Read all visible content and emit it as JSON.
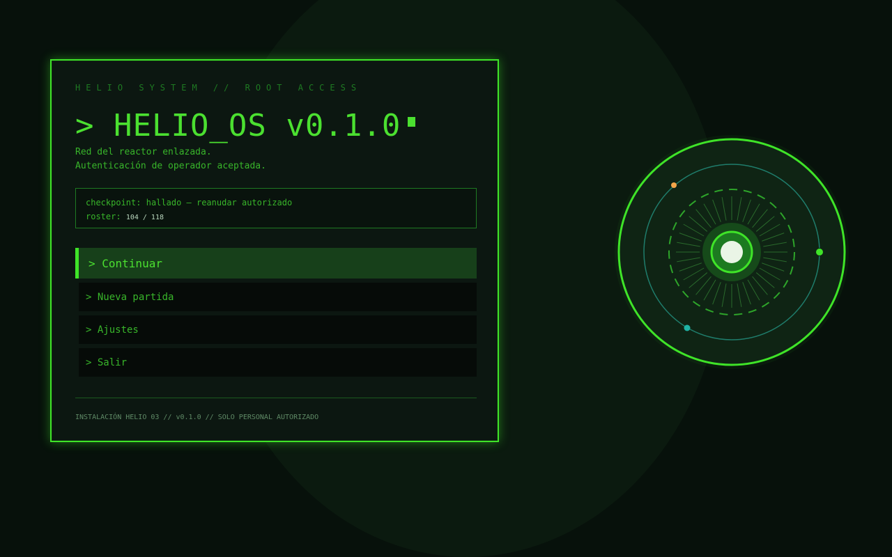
{
  "header": {
    "kicker": "HELIO SYSTEM // ROOT ACCESS",
    "title": "> HELIO_OS v0.1.0"
  },
  "status": {
    "line1": "Red del reactor enlazada.",
    "line2": "Autenticación de operador aceptada."
  },
  "info": {
    "checkpoint_label": "checkpoint:",
    "checkpoint_value": "hallado — reanudar autorizado",
    "roster_label": "roster:",
    "roster_value": "104 / 118"
  },
  "menu": {
    "items": [
      {
        "label": "> Continuar",
        "active": true
      },
      {
        "label": "> Nueva partida",
        "active": false
      },
      {
        "label": "> Ajustes",
        "active": false
      },
      {
        "label": "> Salir",
        "active": false
      }
    ]
  },
  "footer": {
    "text": "INSTALACIÓN HELIO 03 // v0.1.0 // SOLO PERSONAL AUTORIZADO"
  },
  "colors": {
    "accent": "#3fe428",
    "text": "#38b52a",
    "dim": "#1e7a22",
    "orbit_teal": "#1f7d6c",
    "node_orange": "#f2a54a",
    "node_teal": "#1fb3a5",
    "core": "#eaf5e6"
  }
}
